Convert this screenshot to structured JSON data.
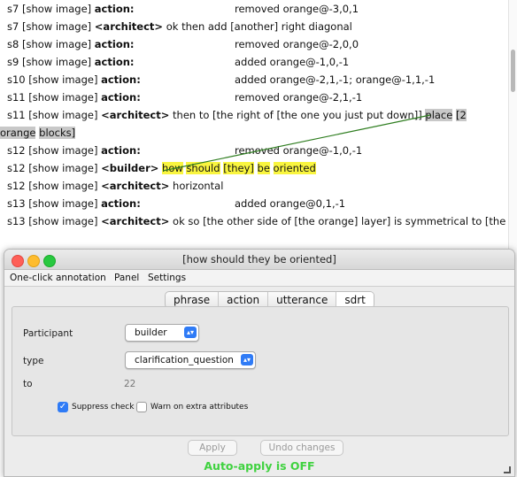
{
  "transcript": {
    "lines": [
      {
        "id": "s7",
        "tag": "[show image]",
        "speaker": "action:",
        "text": "removed orange@-3,0,1"
      },
      {
        "id": "s7",
        "tag": "[show image]",
        "speaker": "<architect>",
        "text": "ok then add [another] right diagonal"
      },
      {
        "id": "s8",
        "tag": "[show image]",
        "speaker": "action:",
        "text": "removed orange@-2,0,0"
      },
      {
        "id": "s9",
        "tag": "[show image]",
        "speaker": "action:",
        "text": "added orange@-1,0,-1"
      },
      {
        "id": "s10",
        "tag": "[show image]",
        "speaker": "action:",
        "text": "added orange@-2,1,-1; orange@-1,1,-1"
      },
      {
        "id": "s11",
        "tag": "[show image]",
        "speaker": "action:",
        "text": "removed orange@-2,1,-1"
      },
      {
        "id": "s11",
        "tag": "[show image]",
        "speaker": "<architect>",
        "text_a": "then to [the right of [the one you just put down]]",
        "text_b": "place",
        "text_c": "[2",
        "text_d": "orange",
        "text_e": "blocks]"
      },
      {
        "id": "s12",
        "tag": "[show image]",
        "speaker": "action:",
        "text": "removed orange@-1,0,-1"
      },
      {
        "id": "s12",
        "tag": "[show image]",
        "speaker": "<builder>",
        "w1": "how",
        "w2": "should",
        "w3": "[they]",
        "w4": "be",
        "w5": "oriented"
      },
      {
        "id": "s12",
        "tag": "[show image]",
        "speaker": "<architect>",
        "text": "horizontal"
      },
      {
        "id": "s13",
        "tag": "[show image]",
        "speaker": "action:",
        "text": "added orange@0,1,-1"
      },
      {
        "id": "s13",
        "tag": "[show image]",
        "speaker": "<architect>",
        "text": "ok so [the other side of [the orange] layer] is symmetrical to [the"
      }
    ]
  },
  "dialog": {
    "title": "[how should they be oriented]",
    "menu": [
      "One-click annotation",
      "Panel",
      "Settings"
    ],
    "tabs": [
      "phrase",
      "action",
      "utterance",
      "sdrt"
    ],
    "selected_tab": "sdrt",
    "fields": {
      "participant_label": "Participant",
      "participant_value": "builder",
      "type_label": "type",
      "type_value": "clarification_question",
      "to_label": "to",
      "to_value": "22"
    },
    "checks": {
      "suppress_label": "Suppress check",
      "suppress_checked": true,
      "warn_label": "Warn on extra attributes",
      "warn_checked": false
    },
    "buttons": {
      "apply": "Apply",
      "undo": "Undo changes"
    },
    "status": "Auto-apply is OFF"
  },
  "colors": {
    "highlight_yellow": "#f9f53f",
    "highlight_gray": "#c8c8c8",
    "link_line": "#2e7d1f",
    "status_green": "#3fd23f",
    "accent_blue": "#2f7bf6"
  }
}
